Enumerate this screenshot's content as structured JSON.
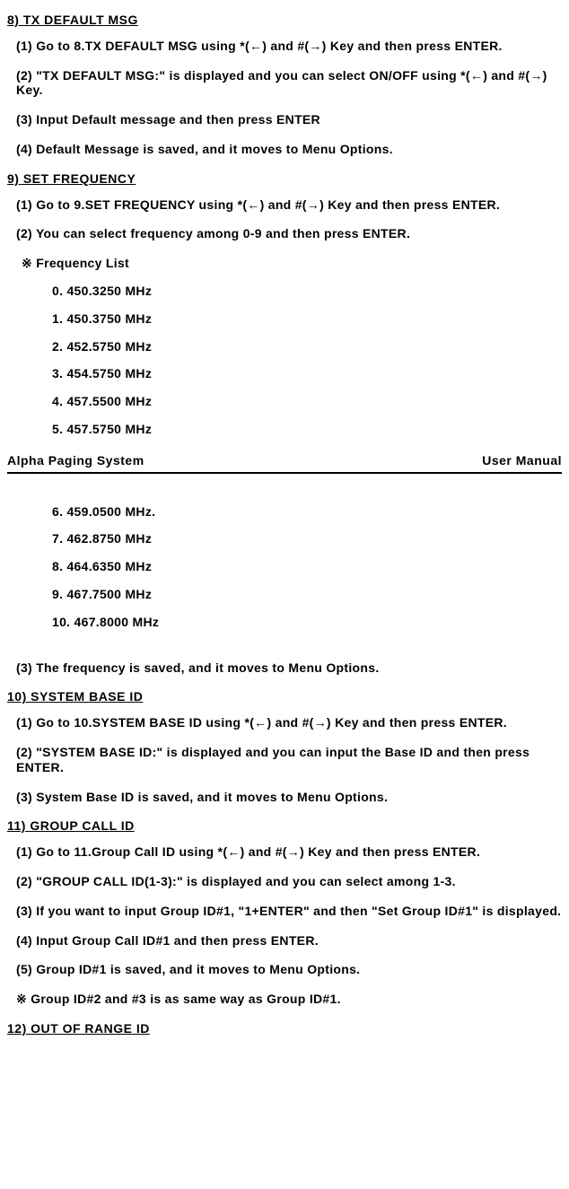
{
  "sections": {
    "s8": {
      "title": "8) TX DEFAULT MSG",
      "steps": [
        "(1) Go to 8.TX DEFAULT MSG using *(←) and #(→) Key and then press ENTER.",
        "(2) \"TX DEFAULT MSG:\" is displayed and you can select ON/OFF using *(←) and #(→) Key.",
        "(3) Input Default message and then press ENTER",
        "(4) Default Message is saved, and it moves to Menu Options."
      ]
    },
    "s9": {
      "title": "9) SET FREQUENCY",
      "steps_top": [
        "(1) Go to 9.SET FREQUENCY using *(←) and #(→) Key and then press ENTER.",
        "(2) You can select frequency among 0-9 and then press ENTER."
      ],
      "freq_note": "※  Frequency List",
      "freq_list_top": [
        "0. 450.3250 MHz",
        "1. 450.3750 MHz",
        "2. 452.5750 MHz",
        "3. 454.5750 MHz",
        "4. 457.5500 MHz",
        "5. 457.5750 MHz"
      ],
      "freq_list_bottom": [
        "6. 459.0500 MHz.",
        "7. 462.8750 MHz",
        "8. 464.6350 MHz",
        "9. 467.7500 MHz",
        "10. 467.8000 MHz"
      ],
      "steps_bottom": [
        "(3) The frequency is saved, and it moves to Menu Options."
      ]
    },
    "s10": {
      "title": "10) SYSTEM BASE ID",
      "steps": [
        "(1) Go to 10.SYSTEM BASE ID using *(←) and #(→) Key and then press ENTER.",
        "(2) \"SYSTEM BASE ID:\" is displayed and you can input the Base ID and then press ENTER.",
        "(3) System Base ID is saved, and it moves to Menu Options."
      ]
    },
    "s11": {
      "title": "11) GROUP CALL ID",
      "steps": [
        "(1) Go to 11.Group Call ID using *(←) and #(→) Key and then press ENTER.",
        "(2) \"GROUP CALL ID(1-3):\" is displayed and you can select among 1-3.",
        "(3) If you want to input Group ID#1, \"1+ENTER\" and then \"Set Group ID#1\" is displayed.",
        "(4) Input Group Call ID#1 and then press ENTER.",
        "(5) Group ID#1 is saved, and it moves to Menu Options."
      ],
      "note": "※  Group ID#2 and #3 is as same way as Group ID#1."
    },
    "s12": {
      "title": "12) OUT OF RANGE ID"
    }
  },
  "footer": {
    "left": "Alpha Paging System",
    "right": "User   Manual"
  }
}
